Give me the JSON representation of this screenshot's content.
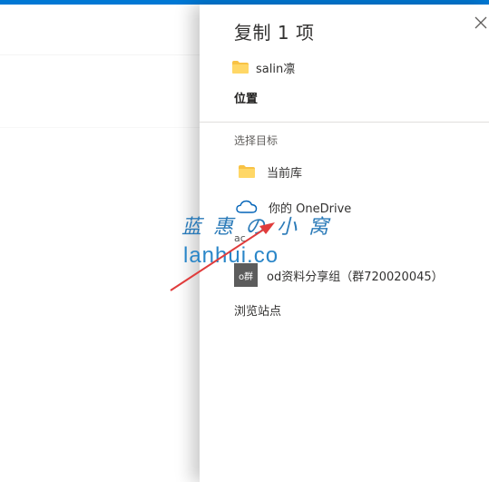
{
  "dialog": {
    "title": "复制 1 项",
    "source_item": {
      "label": "salin凛",
      "icon": "folder-icon"
    },
    "section_title": "位置",
    "choose_target_label": "选择目标",
    "destinations": [
      {
        "label": "当前库",
        "icon": "folder-icon"
      },
      {
        "label": "你的 OneDrive",
        "icon": "cloud-icon"
      },
      {
        "label": "od资料分享组（群720020045）",
        "icon": "group-avatar",
        "avatar_text": "o群"
      }
    ],
    "browse_sites_label": "浏览站点",
    "partially_hidden_text": "ac"
  },
  "watermark": {
    "line1": "蓝 惠 の 小 窝",
    "line2": "lanhui.co"
  },
  "colors": {
    "accent": "#0078d4",
    "folder": "#f8c245",
    "onedrive": "#0364b8",
    "annotation_arrow": "#e03c3c",
    "watermark": "#2a86c8"
  }
}
